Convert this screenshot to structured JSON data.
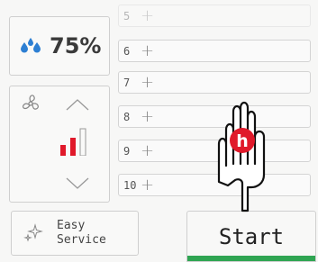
{
  "humidity": {
    "value": "75%",
    "icon": "water-drops-icon"
  },
  "fan": {
    "icon": "fan-icon",
    "up_icon": "chevron-up-icon",
    "down_icon": "chevron-down-icon",
    "level_bars_active": 2,
    "level_bars_total": 3
  },
  "slots": [
    {
      "number": "5"
    },
    {
      "number": "6"
    },
    {
      "number": "7"
    },
    {
      "number": "8"
    },
    {
      "number": "9"
    },
    {
      "number": "10"
    }
  ],
  "slot_plus_symbol": "+",
  "easy_service": {
    "line1": "Easy",
    "line2": "Service",
    "icon": "sparkle-icon"
  },
  "start": {
    "label": "Start"
  },
  "pointer": {
    "badge_letter": "h",
    "icon": "pointing-hand-icon"
  },
  "colors": {
    "accent_red": "#e0192a",
    "start_green": "#2fa552",
    "drop_blue": "#2d7fd3"
  }
}
